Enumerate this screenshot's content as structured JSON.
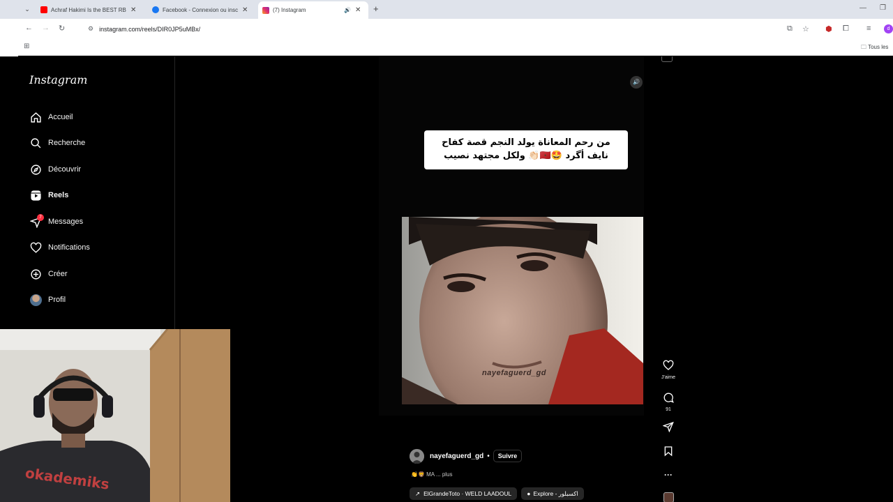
{
  "browser": {
    "tabs": [
      {
        "title": "Achraf Hakimi Is the BEST RB in",
        "favicon_color": "#ff0000",
        "active": false
      },
      {
        "title": "Facebook - Connexion ou inscri",
        "favicon_color": "#1877f2",
        "active": false
      },
      {
        "title": "(7) Instagram",
        "favicon_color": "#e1306c",
        "active": true
      }
    ],
    "url": "instagram.com/reels/DIR0JP5uMBx/",
    "bookmarks_label": "Tous les",
    "profile_letter": "d"
  },
  "instagram": {
    "logo": "Instagram",
    "nav": [
      {
        "label": "Accueil",
        "icon": "home-icon"
      },
      {
        "label": "Recherche",
        "icon": "search-icon"
      },
      {
        "label": "Découvrir",
        "icon": "compass-icon"
      },
      {
        "label": "Reels",
        "icon": "reels-icon",
        "active": true
      },
      {
        "label": "Messages",
        "icon": "messenger-icon",
        "badge": "7"
      },
      {
        "label": "Notifications",
        "icon": "heart-icon"
      },
      {
        "label": "Créer",
        "icon": "plus-square-icon"
      },
      {
        "label": "Profil",
        "icon": "avatar"
      }
    ],
    "reel": {
      "caption_line1": "من رحم المعاناة يولد النجم قصة كفاح",
      "caption_line2": "نايف أگرد 🤩🇲🇦👏🏻 ولكل مجتهد نصيب",
      "watermark": "nayefaguerd_gd",
      "author": "nayefaguerd_gd",
      "follow_label": "Suivre",
      "caption_short": "👏🦁 MA ... plus",
      "audio_chip": "ElGrandeToto · WELD LAADOUL",
      "location_chip": "Explore - اكسبلور",
      "like_label": "J'aime",
      "comments_count": "91"
    }
  },
  "colors": {
    "accent_badge": "#ff3040",
    "background": "#000000"
  }
}
